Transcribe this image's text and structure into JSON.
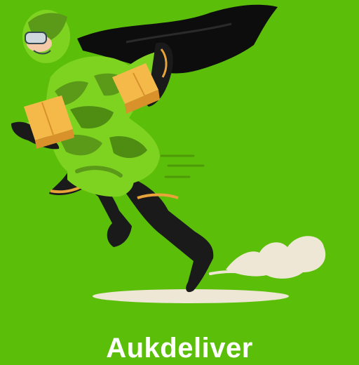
{
  "brand": {
    "name": "Aukdeliver"
  },
  "colors": {
    "background": "#5bbf0a",
    "suit": "#7ed321",
    "suit_dark": "#5a9a18",
    "suit_shade": "#4e8c12",
    "cape": "#0d0d0d",
    "boot": "#1a1a1a",
    "boot_trim": "#e8a33a",
    "box": "#f5b94a",
    "box_shade": "#d9922b",
    "dust": "#efe7d6",
    "text": "#ffffff"
  },
  "illustration": {
    "subject": "superhero-courier-running-with-parcels",
    "icons": [
      "cape-icon",
      "helmet-icon",
      "parcel-box-icon",
      "dust-cloud-icon",
      "ground-shadow-icon"
    ]
  }
}
